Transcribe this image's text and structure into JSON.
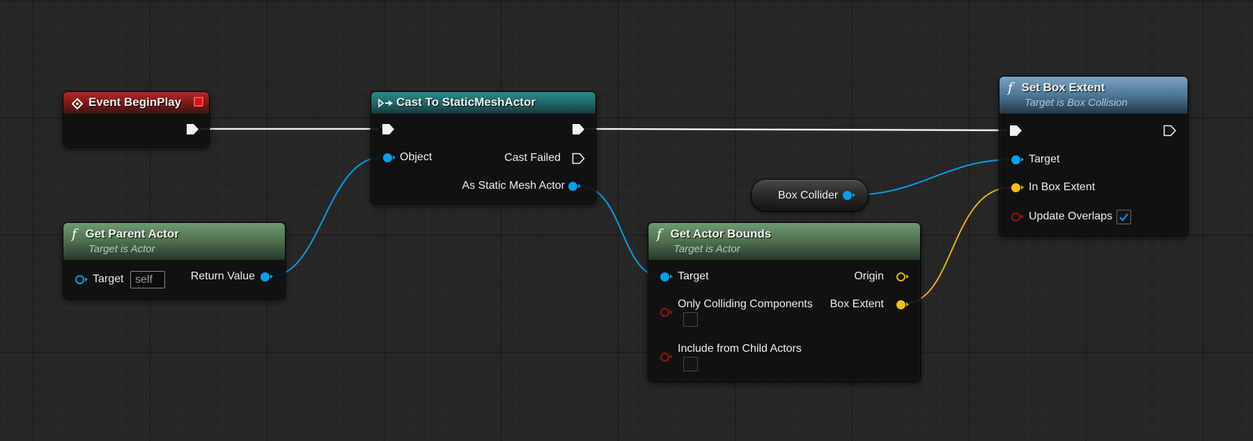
{
  "graph": {
    "nodes": {
      "event_begin_play": {
        "title": "Event BeginPlay",
        "icon": "event-diamond-icon",
        "stop_icon": "red-square-icon",
        "color": "#9b1c1c"
      },
      "cast_to_static_mesh_actor": {
        "title": "Cast To StaticMeshActor",
        "icon": "cast-arrows-icon",
        "color": "#1f6e6e",
        "pins": {
          "object": "Object",
          "cast_failed": "Cast Failed",
          "as_static_mesh_actor": "As Static Mesh Actor"
        }
      },
      "get_parent_actor": {
        "title": "Get Parent Actor",
        "subtitle": "Target is Actor",
        "icon_glyph": "f",
        "color": "#4f744f",
        "pins": {
          "target": "Target",
          "target_value": "self",
          "return_value": "Return Value"
        }
      },
      "box_collider": {
        "label": "Box Collider"
      },
      "get_actor_bounds": {
        "title": "Get Actor Bounds",
        "subtitle": "Target is Actor",
        "icon_glyph": "f",
        "color": "#4f744f",
        "pins": {
          "target": "Target",
          "origin": "Origin",
          "only_colliding_components": "Only Colliding Components",
          "only_colliding_components_checked": false,
          "box_extent": "Box Extent",
          "include_from_child_actors": "Include from Child Actors",
          "include_from_child_actors_checked": false
        }
      },
      "set_box_extent": {
        "title": "Set Box Extent",
        "subtitle": "Target is Box Collision",
        "icon_glyph": "f",
        "color": "#4d7797",
        "pins": {
          "target": "Target",
          "in_box_extent": "In Box Extent",
          "update_overlaps": "Update Overlaps",
          "update_overlaps_checked": true
        }
      }
    },
    "colors": {
      "exec_wire": "#f0f0f0",
      "object_pin": "#0a9eea",
      "vector_pin": "#f2bf1c",
      "bool_pin": "#9a1414",
      "background": "#262626"
    }
  }
}
